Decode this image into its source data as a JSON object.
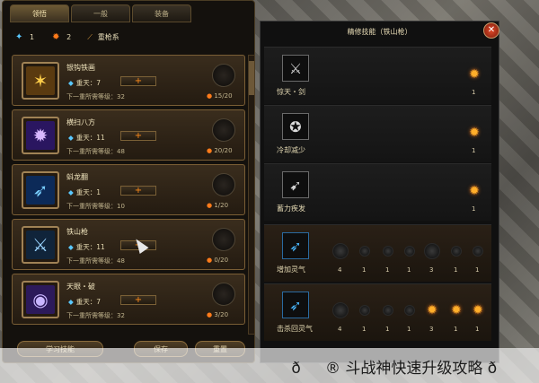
{
  "tabs": [
    {
      "label": "领悟",
      "active": true
    },
    {
      "label": "一般",
      "active": false
    },
    {
      "label": "装备",
      "active": false
    }
  ],
  "points": {
    "blue": "1",
    "orange": "2",
    "category": "重枪系"
  },
  "skills": [
    {
      "name": "银钩铁画",
      "level": "重天：7",
      "req": "下一重所需等级：32",
      "cost": "15/20",
      "color": "#c9a03a",
      "glyph": "✶"
    },
    {
      "name": "横扫八方",
      "level": "重天：11",
      "req": "下一重所需等级：48",
      "cost": "20/20",
      "color": "#8a4cff",
      "glyph": "✹"
    },
    {
      "name": "蚪龙翻",
      "level": "重天：1",
      "req": "下一重所需等级：10",
      "cost": "1/20",
      "color": "#2a8cff",
      "glyph": "➶"
    },
    {
      "name": "铁山枪",
      "level": "重天：11",
      "req": "下一重所需等级：48",
      "cost": "0/20",
      "color": "#2a5a8c",
      "glyph": "⚔"
    },
    {
      "name": "天眼・破",
      "level": "重天：7",
      "req": "下一重所需等级：32",
      "cost": "3/20",
      "color": "#7a5cff",
      "glyph": "◉"
    }
  ],
  "buttons": {
    "learn": "学习技能",
    "save": "保存",
    "reset": "重置"
  },
  "right": {
    "title": "精修技能（铁山枪）",
    "rows": [
      {
        "name": "惊天・剑",
        "value": "1"
      },
      {
        "name": "冷却减少",
        "value": "1"
      },
      {
        "name": "蓄力疾发",
        "value": "1"
      },
      {
        "name": "增加灵气",
        "nums": [
          "4",
          "1",
          "1",
          "1",
          "3",
          "1",
          "1"
        ]
      },
      {
        "name": "击杀回灵气",
        "nums": [
          "4",
          "1",
          "1",
          "1",
          "3",
          "1",
          "1"
        ]
      }
    ]
  },
  "watermark": "ð® 斗战神快速升级攻略 ð"
}
